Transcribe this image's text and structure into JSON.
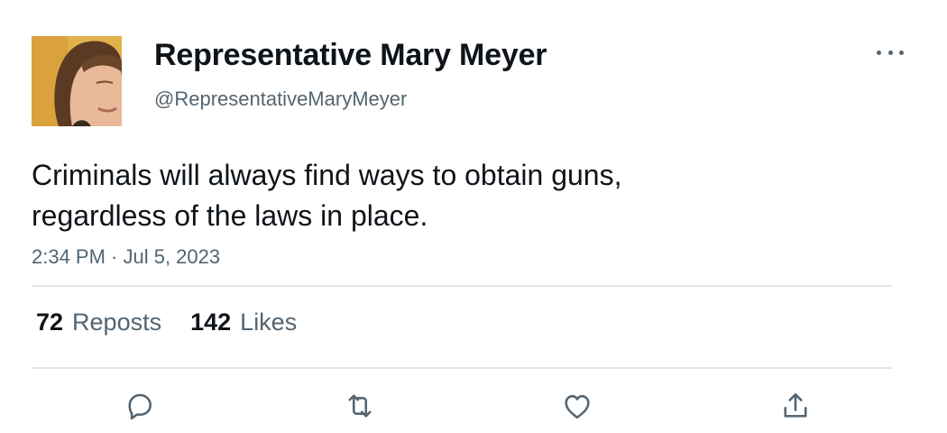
{
  "author": {
    "display_name": "Representative Mary Meyer",
    "handle": "@RepresentativeMaryMeyer",
    "avatar_icon": "profile-photo"
  },
  "tweet": {
    "text_lines": [
      "Criminals will always find ways to obtain guns,",
      "regardless of the laws in place."
    ],
    "timestamp": "2:34 PM · Jul 5, 2023"
  },
  "stats": {
    "reposts_count": "72",
    "reposts_label": "Reposts",
    "likes_count": "142",
    "likes_label": "Likes"
  },
  "actions": {
    "reply_icon": "reply-icon",
    "repost_icon": "repost-icon",
    "like_icon": "like-icon",
    "share_icon": "share-icon",
    "more_icon": "more-icon"
  },
  "colors": {
    "primary_text": "#0f1419",
    "secondary_text": "#536471",
    "divider": "#e1e6ea",
    "background": "#ffffff"
  }
}
